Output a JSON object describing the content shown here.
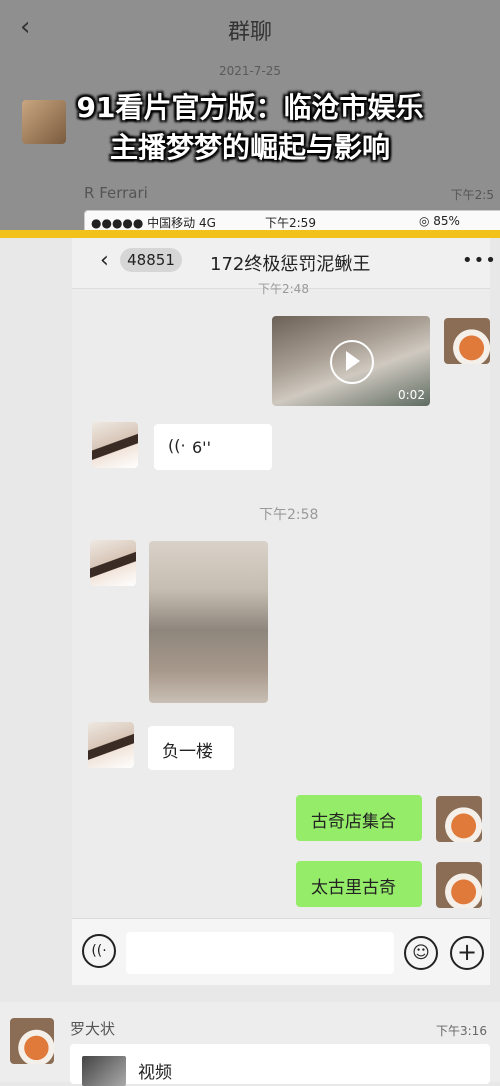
{
  "outer": {
    "back_icon": "chevron-left-icon",
    "title": "群聊",
    "date": "2021-7-25",
    "sender": "R Ferrari",
    "time": "下午2:5",
    "status_carrier": "●●●●● 中国移动  4G",
    "status_time": "下午2:59",
    "status_battery": "◎ 85%"
  },
  "headline": {
    "line1": "91看片官方版：临沧市娱乐",
    "line2": "主播梦梦的崛起与影响"
  },
  "chat": {
    "unread_badge": "48851",
    "title": "172终极惩罚泥鳅王",
    "more_label": "•••",
    "cut_time": "下午2:48",
    "video_duration": "0:02",
    "voice_icon": "((·",
    "voice_length": "6''",
    "timestamp": "下午2:58",
    "msg_left": "负一楼",
    "msg_right_1": "古奇店集合",
    "msg_right_2": "太古里古奇",
    "voice_btn": "((·",
    "emoji_btn": "☺",
    "plus_btn": "+"
  },
  "bottom": {
    "sender": "罗大状",
    "time": "下午3:16",
    "card_label": "视频"
  },
  "colors": {
    "accent_line": "#f2c21b",
    "bubble_green": "#95ec69"
  }
}
